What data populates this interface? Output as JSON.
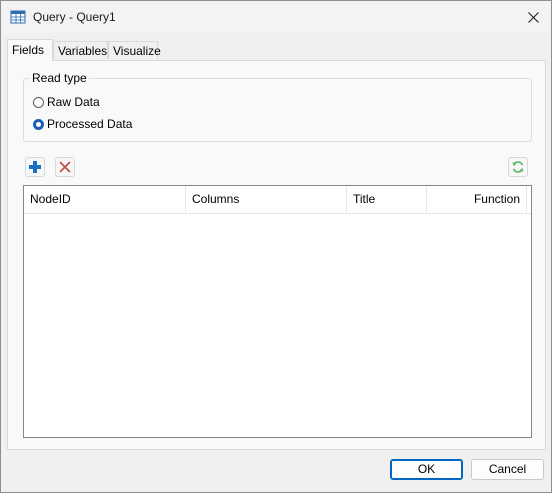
{
  "window": {
    "title": "Query - Query1"
  },
  "tabs": [
    {
      "label": "Fields",
      "active": true
    },
    {
      "label": "Variables",
      "active": false
    },
    {
      "label": "Visualize",
      "active": false
    }
  ],
  "read_type": {
    "legend": "Read type",
    "options": [
      {
        "label": "Raw Data",
        "checked": false
      },
      {
        "label": "Processed Data",
        "checked": true
      }
    ]
  },
  "toolbar": {
    "add_icon": "plus-icon",
    "delete_icon": "delete-x-icon",
    "refresh_icon": "refresh-icon"
  },
  "table": {
    "columns": [
      "NodeID",
      "Columns",
      "Title",
      "Function"
    ],
    "rows": []
  },
  "buttons": {
    "ok": "OK",
    "cancel": "Cancel"
  },
  "colors": {
    "accent": "#0067c0",
    "add": "#1a6fc4",
    "delete": "#c0504d",
    "refresh": "#5cb85c"
  }
}
